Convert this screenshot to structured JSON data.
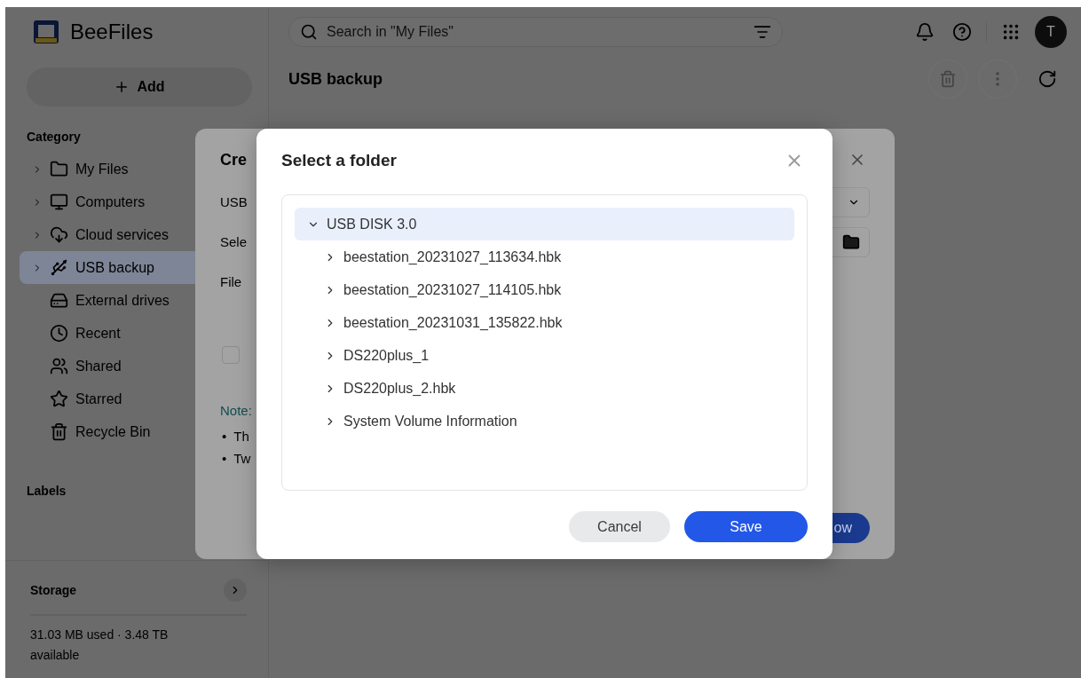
{
  "app": {
    "name": "BeeFiles",
    "add_button": "Add",
    "search": {
      "placeholder": "Search in \"My Files\""
    },
    "avatar": "T"
  },
  "sidebar": {
    "category_label": "Category",
    "items": [
      {
        "label": "My Files",
        "has_children": true,
        "selected": false
      },
      {
        "label": "Computers",
        "has_children": true,
        "selected": false
      },
      {
        "label": "Cloud services",
        "has_children": true,
        "selected": false
      },
      {
        "label": "USB backup",
        "has_children": true,
        "selected": true
      },
      {
        "label": "External drives",
        "has_children": false,
        "selected": false
      },
      {
        "label": "Recent",
        "has_children": false,
        "selected": false
      },
      {
        "label": "Shared",
        "has_children": false,
        "selected": false
      },
      {
        "label": "Starred",
        "has_children": false,
        "selected": false
      },
      {
        "label": "Recycle Bin",
        "has_children": false,
        "selected": false
      }
    ],
    "labels_label": "Labels",
    "storage": {
      "title": "Storage",
      "usage": "31.03 MB used · 3.48 TB available"
    }
  },
  "main": {
    "title": "USB backup"
  },
  "back_dialog": {
    "title": "Cre",
    "fields": [
      {
        "label": "USB",
        "kind": "dropdown"
      },
      {
        "label": "Sele",
        "kind": "folder"
      },
      {
        "label": "File",
        "kind": "text"
      }
    ],
    "option": {
      "checked": false
    },
    "note_label": "Note:",
    "bullets": [
      {
        "marker": "•",
        "text": "Th"
      },
      {
        "marker": "•",
        "text": "Tw"
      }
    ],
    "button": "ow"
  },
  "dialog": {
    "title": "Select a folder",
    "tree": {
      "label": "USB DISK 3.0",
      "expanded": true,
      "selected": true,
      "children": [
        {
          "label": "beestation_20231027_113634.hbk",
          "expanded": false,
          "selected": false
        },
        {
          "label": "beestation_20231027_114105.hbk",
          "expanded": false,
          "selected": false
        },
        {
          "label": "beestation_20231031_135822.hbk",
          "expanded": false,
          "selected": false
        },
        {
          "label": "DS220plus_1",
          "expanded": false,
          "selected": false
        },
        {
          "label": "DS220plus_2.hbk",
          "expanded": false,
          "selected": false
        },
        {
          "label": "System Volume Information",
          "expanded": false,
          "selected": false
        }
      ]
    },
    "buttons": [
      {
        "label": "Cancel",
        "kind": "secondary"
      },
      {
        "label": "Save",
        "kind": "primary"
      }
    ]
  }
}
